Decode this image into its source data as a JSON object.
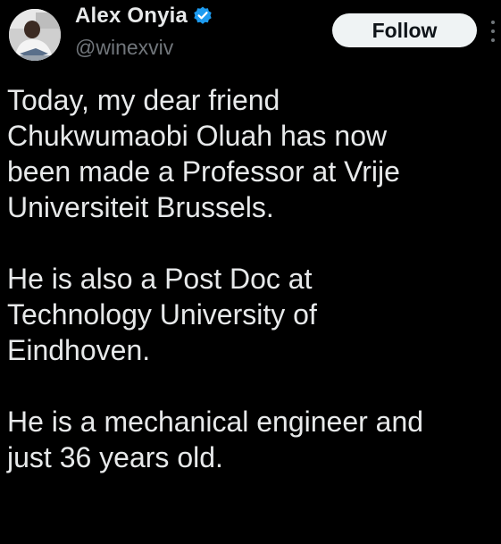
{
  "author": {
    "display_name": "Alex Onyia",
    "handle": "@winexviv",
    "verified": true,
    "verified_color": "#1d9bf0"
  },
  "actions": {
    "follow_label": "Follow",
    "more_icon": "more-vertical-icon"
  },
  "tweet": {
    "paragraphs": [
      {
        "lines": [
          "Today, my dear friend",
          "Chukwumaobi Oluah has now",
          "been made a Professor at Vrije",
          "Universiteit Brussels."
        ]
      },
      {
        "lines": [
          "He is also a Post Doc at",
          "Technology University of",
          "Eindhoven."
        ]
      },
      {
        "lines": [
          "He is a mechanical engineer and",
          "just 36 years old."
        ]
      }
    ]
  },
  "colors": {
    "background": "#000000",
    "text": "#e7e9ea",
    "muted": "#71767b",
    "button_bg": "#eff3f4",
    "button_text": "#0f1419"
  }
}
